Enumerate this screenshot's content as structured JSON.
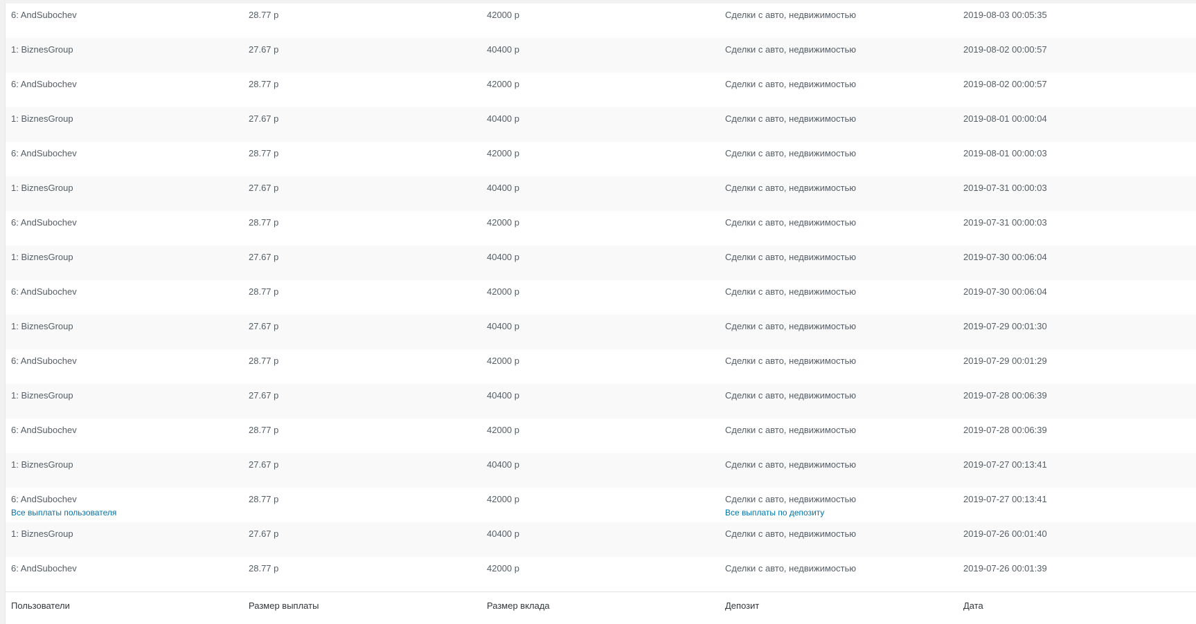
{
  "table": {
    "columns": [
      "Пользователи",
      "Размер выплаты",
      "Размер вклада",
      "Депозит",
      "Дата"
    ],
    "row_actions": {
      "user_payouts": "Все выплаты пользователя",
      "deposit_payouts": "Все выплаты по депозиту"
    },
    "rows": [
      {
        "user": "6: AndSubochev",
        "payout": "28.77 р",
        "amount": "42000 р",
        "deposit": "Сделки с авто, недвижимостью",
        "date": "2019-08-03 00:05:35"
      },
      {
        "user": "1: BiznesGroup",
        "payout": "27.67 р",
        "amount": "40400 р",
        "deposit": "Сделки с авто, недвижимостью",
        "date": "2019-08-02 00:00:57"
      },
      {
        "user": "6: AndSubochev",
        "payout": "28.77 р",
        "amount": "42000 р",
        "deposit": "Сделки с авто, недвижимостью",
        "date": "2019-08-02 00:00:57"
      },
      {
        "user": "1: BiznesGroup",
        "payout": "27.67 р",
        "amount": "40400 р",
        "deposit": "Сделки с авто, недвижимостью",
        "date": "2019-08-01 00:00:04"
      },
      {
        "user": "6: AndSubochev",
        "payout": "28.77 р",
        "amount": "42000 р",
        "deposit": "Сделки с авто, недвижимостью",
        "date": "2019-08-01 00:00:03"
      },
      {
        "user": "1: BiznesGroup",
        "payout": "27.67 р",
        "amount": "40400 р",
        "deposit": "Сделки с авто, недвижимостью",
        "date": "2019-07-31 00:00:03"
      },
      {
        "user": "6: AndSubochev",
        "payout": "28.77 р",
        "amount": "42000 р",
        "deposit": "Сделки с авто, недвижимостью",
        "date": "2019-07-31 00:00:03"
      },
      {
        "user": "1: BiznesGroup",
        "payout": "27.67 р",
        "amount": "40400 р",
        "deposit": "Сделки с авто, недвижимостью",
        "date": "2019-07-30 00:06:04"
      },
      {
        "user": "6: AndSubochev",
        "payout": "28.77 р",
        "amount": "42000 р",
        "deposit": "Сделки с авто, недвижимостью",
        "date": "2019-07-30 00:06:04"
      },
      {
        "user": "1: BiznesGroup",
        "payout": "27.67 р",
        "amount": "40400 р",
        "deposit": "Сделки с авто, недвижимостью",
        "date": "2019-07-29 00:01:30"
      },
      {
        "user": "6: AndSubochev",
        "payout": "28.77 р",
        "amount": "42000 р",
        "deposit": "Сделки с авто, недвижимостью",
        "date": "2019-07-29 00:01:29"
      },
      {
        "user": "1: BiznesGroup",
        "payout": "27.67 р",
        "amount": "40400 р",
        "deposit": "Сделки с авто, недвижимостью",
        "date": "2019-07-28 00:06:39"
      },
      {
        "user": "6: AndSubochev",
        "payout": "28.77 р",
        "amount": "42000 р",
        "deposit": "Сделки с авто, недвижимостью",
        "date": "2019-07-28 00:06:39"
      },
      {
        "user": "1: BiznesGroup",
        "payout": "27.67 р",
        "amount": "40400 р",
        "deposit": "Сделки с авто, недвижимостью",
        "date": "2019-07-27 00:13:41"
      },
      {
        "user": "6: AndSubochev",
        "payout": "28.77 р",
        "amount": "42000 р",
        "deposit": "Сделки с авто, недвижимостью",
        "date": "2019-07-27 00:13:41"
      },
      {
        "user": "1: BiznesGroup",
        "payout": "27.67 р",
        "amount": "40400 р",
        "deposit": "Сделки с авто, недвижимостью",
        "date": "2019-07-26 00:01:40"
      },
      {
        "user": "6: AndSubochev",
        "payout": "28.77 р",
        "amount": "42000 р",
        "deposit": "Сделки с авто, недвижимостью",
        "date": "2019-07-26 00:01:39"
      }
    ]
  }
}
